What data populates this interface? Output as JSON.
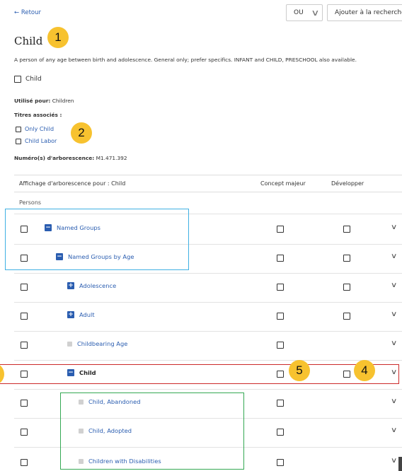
{
  "header": {
    "back_label": "← Retour",
    "operator_value": "OU",
    "add_button_label": "Ajouter à la recherche"
  },
  "term": {
    "title": "Child",
    "description": "A person of any age between birth and adolescence. General only; prefer specifics. INFANT and CHILD, PRESCHOOL also available.",
    "checkbox_label": "Child",
    "used_for_label": "Utilisé pour:",
    "used_for_value": "Children",
    "related_label": "Titres associés :",
    "related": [
      "Only Child",
      "Child Labor"
    ],
    "tree_label": "Numéro(s) d'arborescence:",
    "tree_value": "M1.471.392"
  },
  "tree": {
    "col_term": "Affichage d'arborescence pour : Child",
    "col_major": "Concept majeur",
    "col_expand": "Développer",
    "root_label": "Persons",
    "rows": [
      {
        "label": "Named Groups",
        "icon": "minus-icon"
      },
      {
        "label": "Named Groups by Age",
        "icon": "minus-icon"
      },
      {
        "label": "Adolescence",
        "icon": "plus-icon"
      },
      {
        "label": "Adult",
        "icon": "plus-icon"
      },
      {
        "label": "Childbearing Age",
        "icon": "leaf-icon"
      },
      {
        "label": "Child",
        "icon": "minus-icon"
      },
      {
        "label": "Child, Abandoned",
        "icon": "leaf-icon"
      },
      {
        "label": "Child, Adopted",
        "icon": "leaf-icon"
      },
      {
        "label": "Children with Disabilities",
        "icon": "leaf-icon"
      }
    ]
  },
  "annotations": {
    "b1": "1",
    "b2": "2",
    "b4": "4",
    "b5": "5",
    "colors": {
      "badge": "#f7c22f",
      "blue_box": "#3fb0e3",
      "red_box": "#cc2a2a",
      "green_box": "#34a853"
    }
  }
}
